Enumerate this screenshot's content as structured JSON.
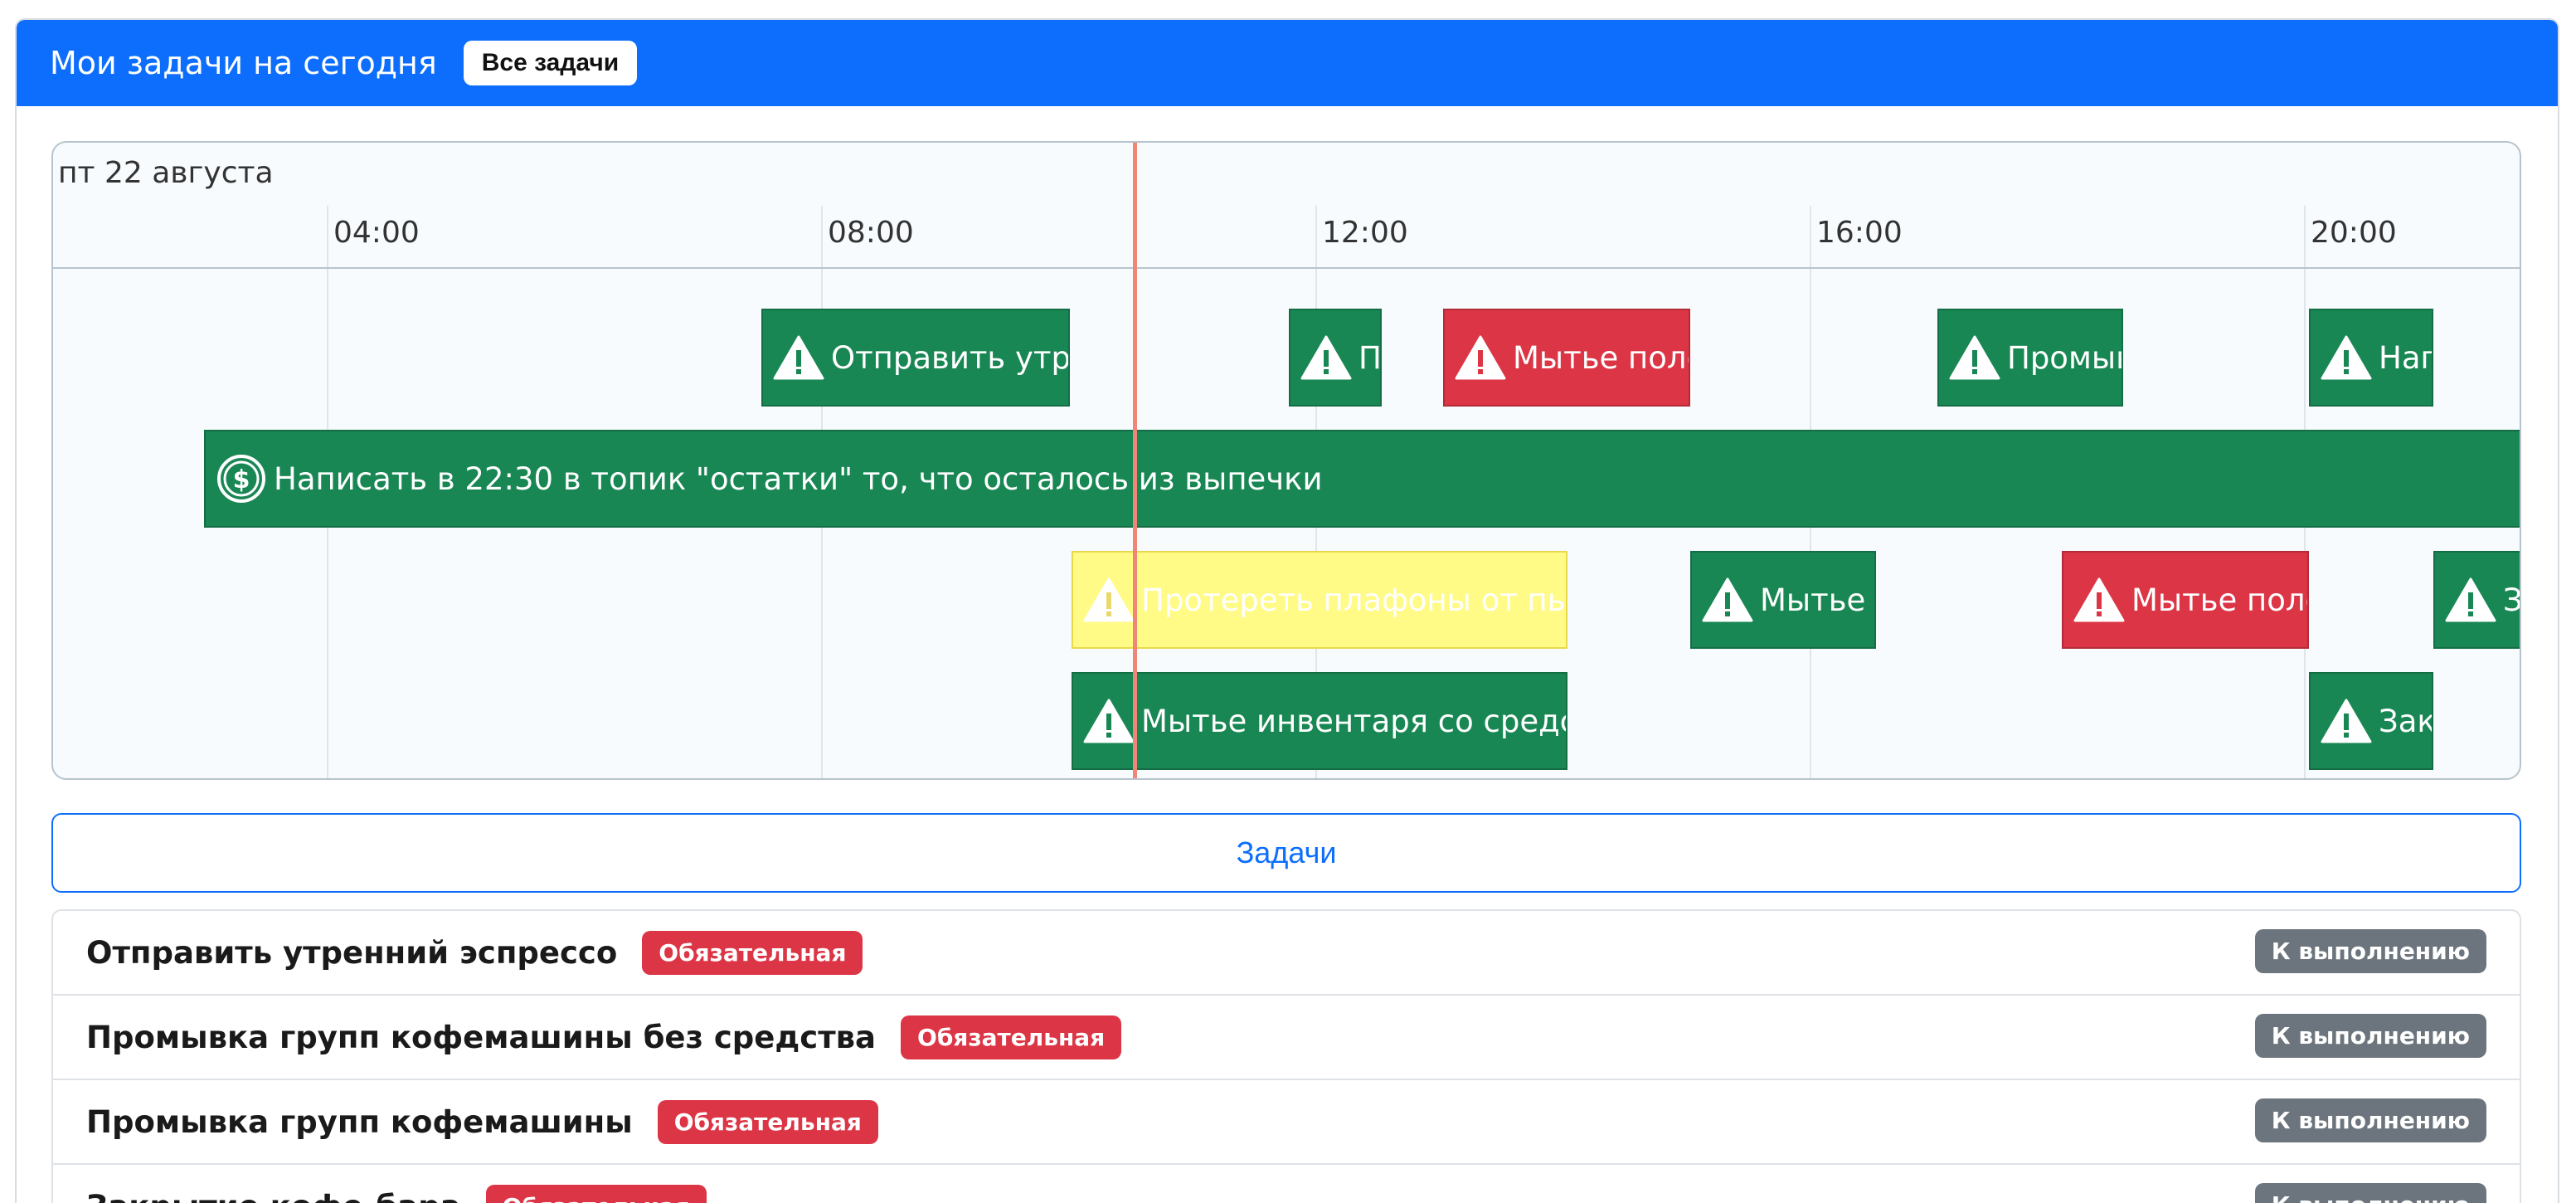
{
  "header": {
    "title": "Мои задачи на сегодня",
    "all_tasks_label": "Все задачи"
  },
  "timeline": {
    "date_label": "пт 22 августа",
    "hours": [
      "04:00",
      "08:00",
      "12:00",
      "16:00",
      "20:00"
    ],
    "tasks": [
      {
        "label": "Отправить утренний эспрессо",
        "color": "green",
        "icon": "warning-icon"
      },
      {
        "label": "Промывка групп кофемашины без средства",
        "color": "green",
        "icon": "warning-icon"
      },
      {
        "label": "Мытье полов",
        "color": "red",
        "icon": "warning-icon"
      },
      {
        "label": "Промывка групп кофемашины",
        "color": "green",
        "icon": "warning-icon"
      },
      {
        "label": "Наполнить",
        "color": "green",
        "icon": "warning-icon"
      },
      {
        "label": "Написать в 22:30 в топик \"остатки\" то, что осталось из выпечки",
        "color": "green",
        "icon": "dollar-icon"
      },
      {
        "label": "Протереть плафоны от пыли",
        "color": "yellow",
        "icon": "warning-icon"
      },
      {
        "label": "Мытье посуды",
        "color": "green",
        "icon": "warning-icon"
      },
      {
        "label": "Мытье полов",
        "color": "red",
        "icon": "warning-icon"
      },
      {
        "label": "Закрытие",
        "color": "green",
        "icon": "warning-icon"
      },
      {
        "label": "Мытье инвентаря со средством",
        "color": "green",
        "icon": "warning-icon"
      },
      {
        "label": "Закрытие кофе-бара",
        "color": "green",
        "icon": "warning-icon"
      }
    ]
  },
  "tasks_button_label": "Задачи",
  "task_list": [
    {
      "title": "Отправить утренний эспрессо",
      "badge": "Обязательная",
      "status": "К выполнению"
    },
    {
      "title": "Промывка групп кофемашины без средства",
      "badge": "Обязательная",
      "status": "К выполнению"
    },
    {
      "title": "Промывка групп кофемашины",
      "badge": "Обязательная",
      "status": "К выполнению"
    },
    {
      "title": "Закрытие кофе-бара",
      "badge": "Обязательная",
      "status": "К выполнению"
    }
  ],
  "colors": {
    "primary": "#0d6efd",
    "success": "#198754",
    "danger": "#dc3545",
    "warning_yellow": "#fffb86",
    "secondary": "#6c757d",
    "now_line": "#f08676"
  }
}
